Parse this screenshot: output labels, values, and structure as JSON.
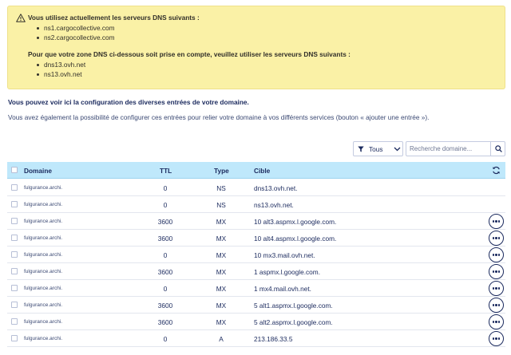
{
  "warning": {
    "line1": "Vous utilisez actuellement les serveurs DNS suivants :",
    "current_servers": [
      "ns1.cargocollective.com",
      "ns2.cargocollective.com"
    ],
    "line2": "Pour que votre zone DNS ci-dessous soit prise en compte, veuillez utiliser les serveurs DNS suivants :",
    "required_servers": [
      "dns13.ovh.net",
      "ns13.ovh.net"
    ],
    "color": "#faf1a6"
  },
  "intro": {
    "bold": "Vous pouvez voir ici la configuration des diverses entrées de votre domaine.",
    "text": "Vous avez également la possibilité de configurer ces entrées pour relier votre domaine à vos différents services (bouton « ajouter une entrée »)."
  },
  "filter": {
    "selected": "Tous"
  },
  "search": {
    "placeholder": "Recherche domaine..."
  },
  "table": {
    "headers": {
      "domain": "Domaine",
      "ttl": "TTL",
      "type": "Type",
      "target": "Cible"
    },
    "header_color": "#bfe8fb",
    "rows": [
      {
        "domain": "fulgurance.archi.",
        "ttl": "0",
        "type": "NS",
        "target": "dns13.ovh.net.",
        "actions": false
      },
      {
        "domain": "fulgurance.archi.",
        "ttl": "0",
        "type": "NS",
        "target": "ns13.ovh.net.",
        "actions": false
      },
      {
        "domain": "fulgurance.archi.",
        "ttl": "3600",
        "type": "MX",
        "target": "10 alt3.aspmx.l.google.com.",
        "actions": true
      },
      {
        "domain": "fulgurance.archi.",
        "ttl": "3600",
        "type": "MX",
        "target": "10 alt4.aspmx.l.google.com.",
        "actions": true
      },
      {
        "domain": "fulgurance.archi.",
        "ttl": "0",
        "type": "MX",
        "target": "10 mx3.mail.ovh.net.",
        "actions": true
      },
      {
        "domain": "fulgurance.archi.",
        "ttl": "3600",
        "type": "MX",
        "target": "1 aspmx.l.google.com.",
        "actions": true
      },
      {
        "domain": "fulgurance.archi.",
        "ttl": "0",
        "type": "MX",
        "target": "1 mx4.mail.ovh.net.",
        "actions": true
      },
      {
        "domain": "fulgurance.archi.",
        "ttl": "3600",
        "type": "MX",
        "target": "5 alt1.aspmx.l.google.com.",
        "actions": true
      },
      {
        "domain": "fulgurance.archi.",
        "ttl": "3600",
        "type": "MX",
        "target": "5 alt2.aspmx.l.google.com.",
        "actions": true
      },
      {
        "domain": "fulgurance.archi.",
        "ttl": "0",
        "type": "A",
        "target": "213.186.33.5",
        "actions": true
      }
    ]
  },
  "icons": {
    "warning": "warning-triangle-icon",
    "filter": "funnel-icon",
    "dropdown": "chevron-down-icon",
    "search": "search-icon",
    "refresh": "refresh-icon",
    "row_menu": "more-options-icon"
  }
}
